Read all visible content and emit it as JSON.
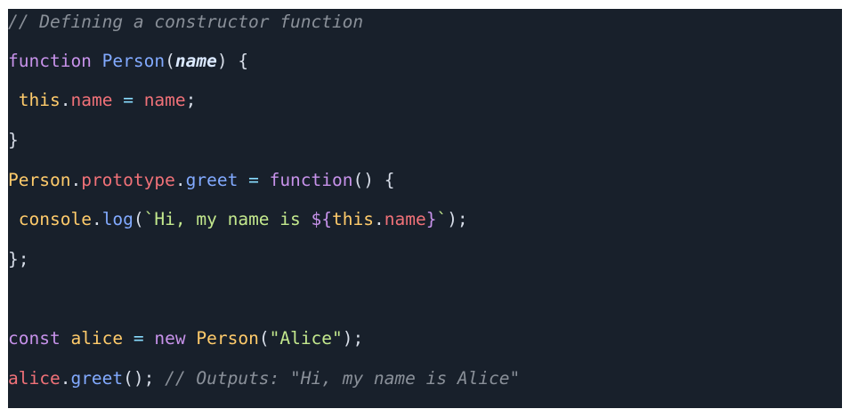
{
  "code_block": {
    "lines": [
      [
        {
          "text": "// Defining a constructor function",
          "kind": "comment"
        }
      ],
      [
        {
          "text": "function",
          "kind": "keyword"
        },
        {
          "text": " ",
          "kind": "space"
        },
        {
          "text": "Person",
          "kind": "fn"
        },
        {
          "text": "(",
          "kind": "punct"
        },
        {
          "text": "name",
          "kind": "param"
        },
        {
          "text": ") {",
          "kind": "punct"
        }
      ],
      [
        {
          "text": " ",
          "kind": "space"
        },
        {
          "text": "this",
          "kind": "this"
        },
        {
          "text": ".",
          "kind": "punct"
        },
        {
          "text": "name",
          "kind": "prop"
        },
        {
          "text": " ",
          "kind": "space"
        },
        {
          "text": "=",
          "kind": "op"
        },
        {
          "text": " ",
          "kind": "space"
        },
        {
          "text": "name",
          "kind": "prop"
        },
        {
          "text": ";",
          "kind": "punct"
        }
      ],
      [
        {
          "text": "}",
          "kind": "punct"
        }
      ],
      [
        {
          "text": "Person",
          "kind": "class"
        },
        {
          "text": ".",
          "kind": "punct"
        },
        {
          "text": "prototype",
          "kind": "prop"
        },
        {
          "text": ".",
          "kind": "punct"
        },
        {
          "text": "greet",
          "kind": "fn"
        },
        {
          "text": " ",
          "kind": "space"
        },
        {
          "text": "=",
          "kind": "op"
        },
        {
          "text": " ",
          "kind": "space"
        },
        {
          "text": "function",
          "kind": "keyword"
        },
        {
          "text": "() {",
          "kind": "punct"
        }
      ],
      [
        {
          "text": " ",
          "kind": "space"
        },
        {
          "text": "console",
          "kind": "var"
        },
        {
          "text": ".",
          "kind": "punct"
        },
        {
          "text": "log",
          "kind": "fn"
        },
        {
          "text": "(",
          "kind": "punct"
        },
        {
          "text": "`Hi, my name is ",
          "kind": "str"
        },
        {
          "text": "${",
          "kind": "interp"
        },
        {
          "text": "this",
          "kind": "this"
        },
        {
          "text": ".",
          "kind": "punct"
        },
        {
          "text": "name",
          "kind": "prop"
        },
        {
          "text": "}",
          "kind": "interp"
        },
        {
          "text": "`",
          "kind": "str"
        },
        {
          "text": ");",
          "kind": "punct"
        }
      ],
      [
        {
          "text": "};",
          "kind": "punct"
        }
      ],
      [],
      [
        {
          "text": "const",
          "kind": "keyword"
        },
        {
          "text": " ",
          "kind": "space"
        },
        {
          "text": "alice",
          "kind": "var"
        },
        {
          "text": " ",
          "kind": "space"
        },
        {
          "text": "=",
          "kind": "op"
        },
        {
          "text": " ",
          "kind": "space"
        },
        {
          "text": "new",
          "kind": "keyword"
        },
        {
          "text": " ",
          "kind": "space"
        },
        {
          "text": "Person",
          "kind": "class"
        },
        {
          "text": "(",
          "kind": "punct"
        },
        {
          "text": "\"Alice\"",
          "kind": "str"
        },
        {
          "text": ");",
          "kind": "punct"
        }
      ],
      [
        {
          "text": "alice",
          "kind": "obj"
        },
        {
          "text": ".",
          "kind": "punct"
        },
        {
          "text": "greet",
          "kind": "fn"
        },
        {
          "text": "(); ",
          "kind": "punct"
        },
        {
          "text": "// Outputs: \"Hi, my name is Alice\"",
          "kind": "comment"
        }
      ]
    ]
  },
  "colors": {
    "background": "#18202b",
    "comment": "#8a9099",
    "keyword": "#c792ea",
    "function": "#82aaff",
    "property": "#f07178",
    "this": "#ffcb6b",
    "string": "#c3e88d"
  }
}
